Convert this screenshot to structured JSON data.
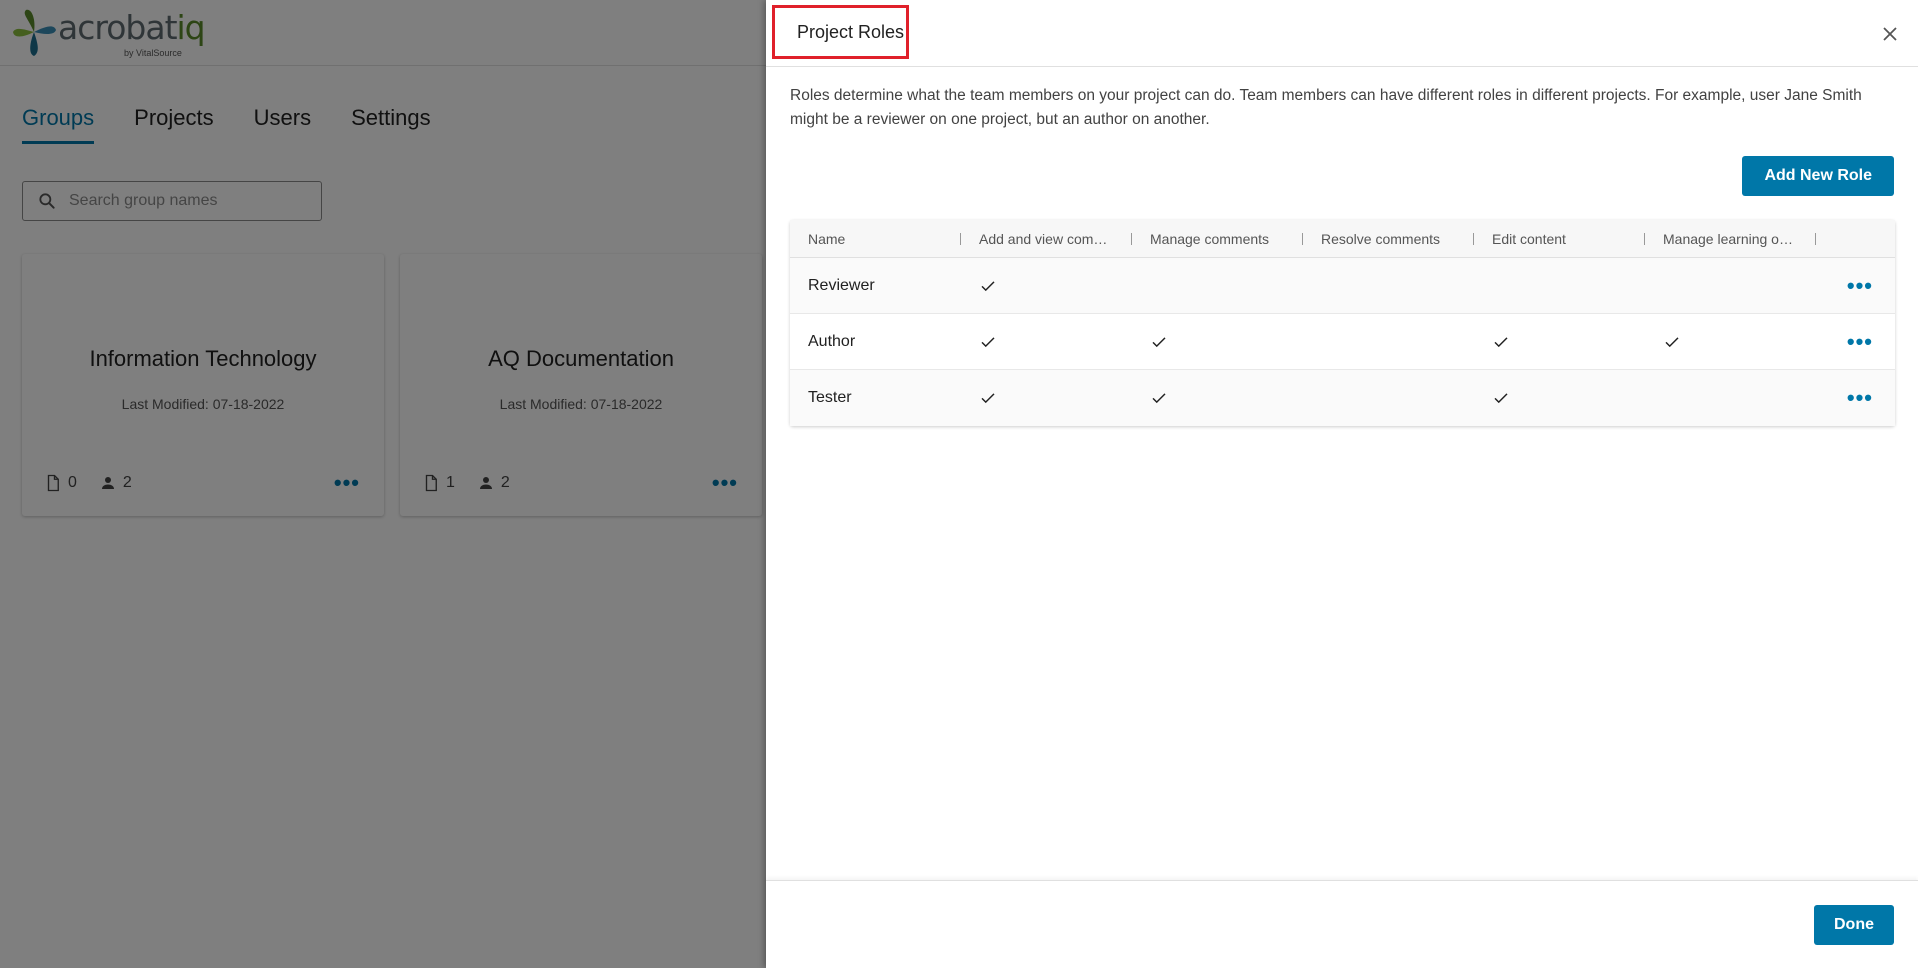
{
  "app": {
    "logo_text_main": "acrobat",
    "logo_text_accent": "iq",
    "logo_byline": "by VitalSource",
    "nav_tabs": [
      "Groups",
      "Projects",
      "Users",
      "Settings"
    ],
    "search_placeholder": "Search group names",
    "cards": [
      {
        "title": "Information Technology",
        "last_modified": "Last Modified: 07-18-2022",
        "projects": "0",
        "users": "2"
      },
      {
        "title": "AQ Documentation",
        "last_modified": "Last Modified: 07-18-2022",
        "projects": "1",
        "users": "2"
      }
    ]
  },
  "panel": {
    "title": "Project Roles",
    "description": "Roles determine what the team members on your project can do. Team members can have different roles in different projects. For example, user Jane Smith might be a reviewer on one project, but an author on another.",
    "add_role_label": "Add New Role",
    "done_label": "Done",
    "columns": [
      "Name",
      "Add and view comments",
      "Manage comments",
      "Resolve comments",
      "Edit content",
      "Manage learning objectives"
    ],
    "rows": [
      {
        "name": "Reviewer",
        "perms": [
          true,
          false,
          false,
          false,
          false
        ]
      },
      {
        "name": "Author",
        "perms": [
          true,
          true,
          false,
          true,
          true
        ]
      },
      {
        "name": "Tester",
        "perms": [
          true,
          true,
          false,
          true,
          false
        ]
      }
    ]
  },
  "colors": {
    "accent": "#0077a8",
    "highlight": "#e0202a",
    "overlay": "rgba(0,0,0,0.5)"
  },
  "icons": {
    "close": "close-icon",
    "check": "checkmark-icon",
    "more": "more-horizontal-icon",
    "search": "search-icon",
    "file": "file-icon",
    "person": "person-icon"
  }
}
